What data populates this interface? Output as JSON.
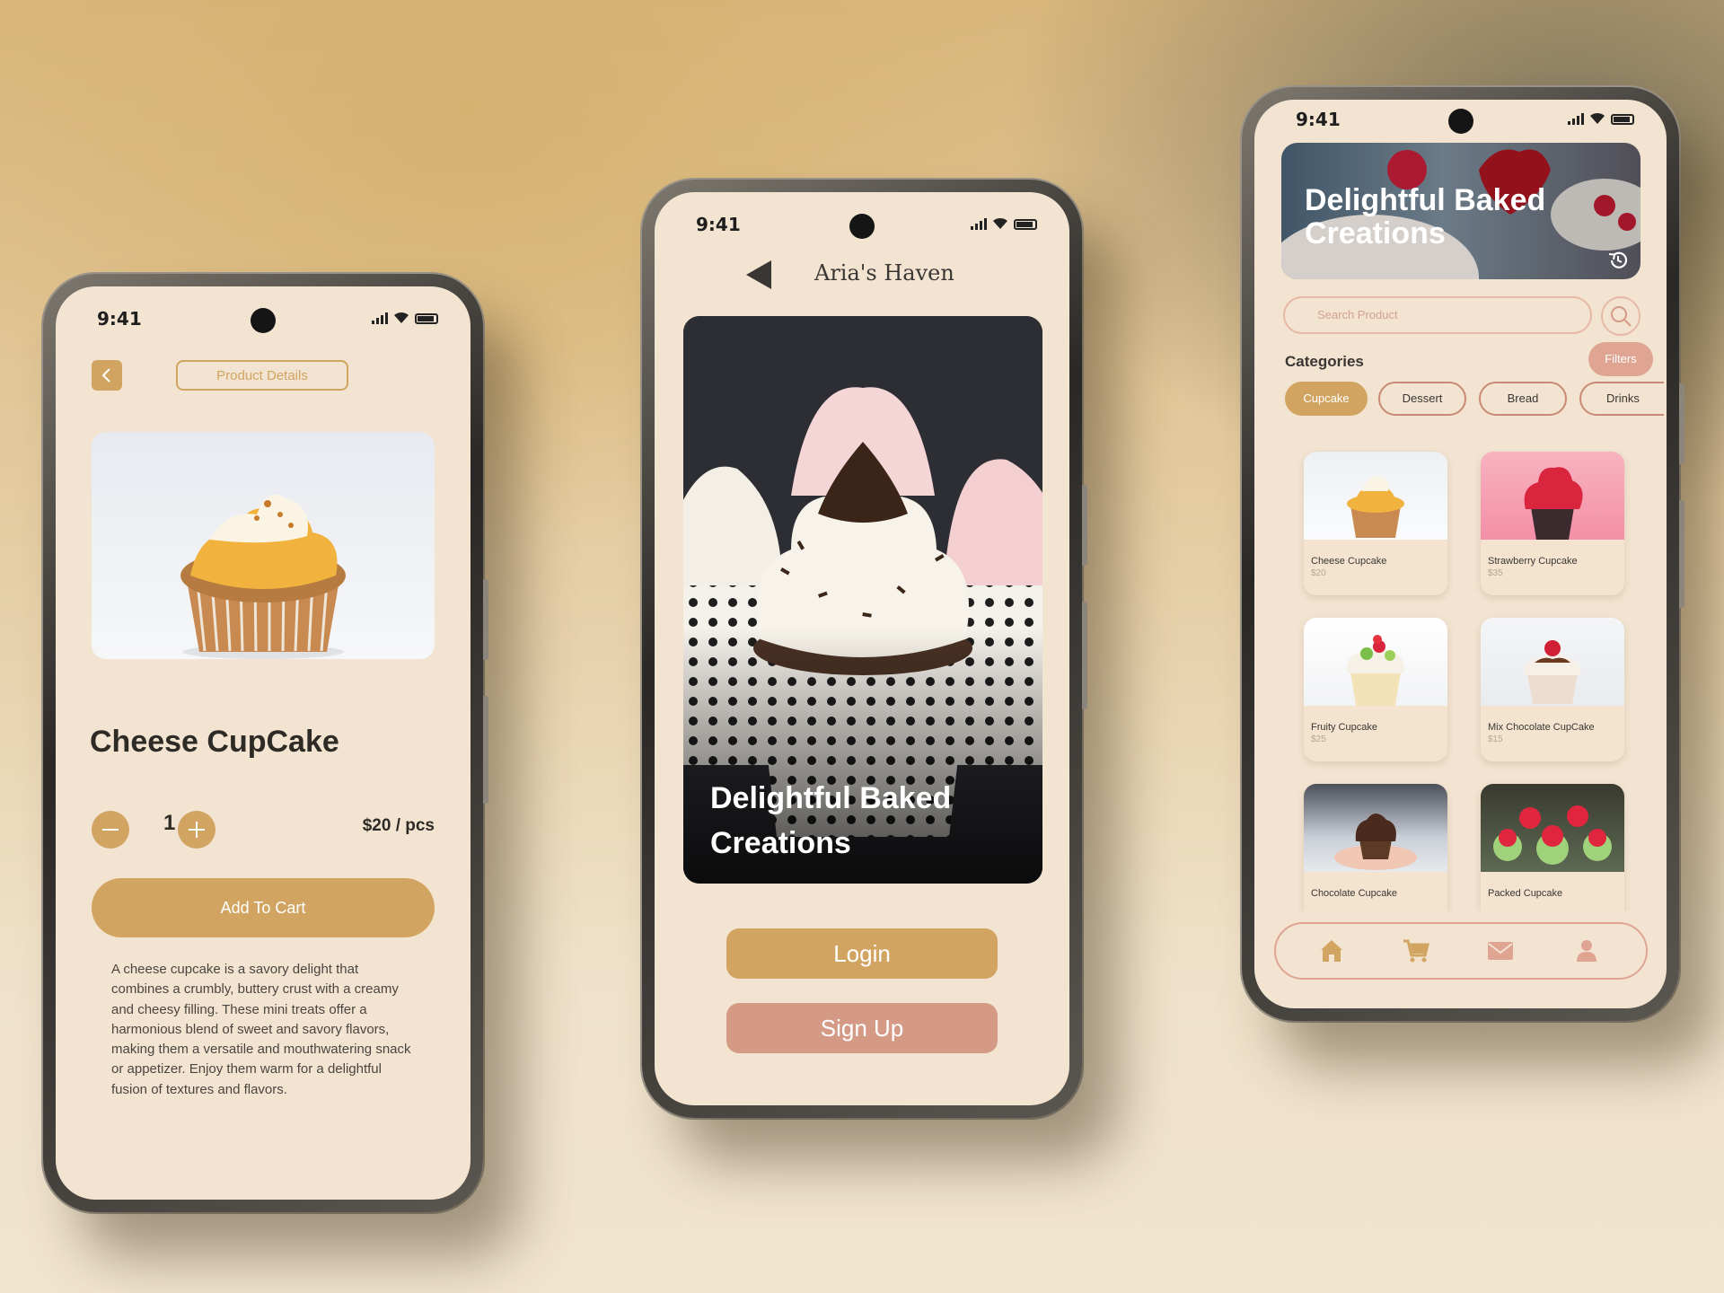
{
  "status": {
    "time": "9:41"
  },
  "product_screen": {
    "header_title": "Product Details",
    "name": "Cheese CupCake",
    "quantity": "1",
    "price": "$20 / pcs",
    "add_to_cart": "Add To Cart",
    "description": "A cheese cupcake is a savory delight that combines a crumbly, buttery crust with a creamy and cheesy filling. These mini treats offer a harmonious blend of sweet and savory flavors, making them a versatile and mouthwatering snack or appetizer. Enjoy them warm for a delightful fusion of textures and flavors."
  },
  "welcome_screen": {
    "brand": "Aria's Haven",
    "hero_title_line1": "Delightful Baked",
    "hero_title_line2": "Creations",
    "login": "Login",
    "signup": "Sign Up"
  },
  "home_screen": {
    "banner_line1": "Delightful Baked",
    "banner_line2": "Creations",
    "search_placeholder": "Search Product",
    "categories_title": "Categories",
    "filters": "Filters",
    "chips": [
      "Cupcake",
      "Dessert",
      "Bread",
      "Drinks"
    ],
    "products": [
      {
        "name": "Cheese Cupcake",
        "price": "$20"
      },
      {
        "name": "Strawberry Cupcake",
        "price": "$35"
      },
      {
        "name": "Fruity Cupcake",
        "price": "$25"
      },
      {
        "name": "Mix Chocolate CupCake",
        "price": "$15"
      },
      {
        "name": "Chocolate Cupcake",
        "price": ""
      },
      {
        "name": "Packed Cupcake",
        "price": ""
      }
    ],
    "nav": [
      "home-icon",
      "cart-icon",
      "mail-icon",
      "user-icon"
    ]
  },
  "colors": {
    "gold": "#d2a461",
    "rose": "#d59a86",
    "cream": "#f2e4d1",
    "dark": "#2e2a26"
  }
}
